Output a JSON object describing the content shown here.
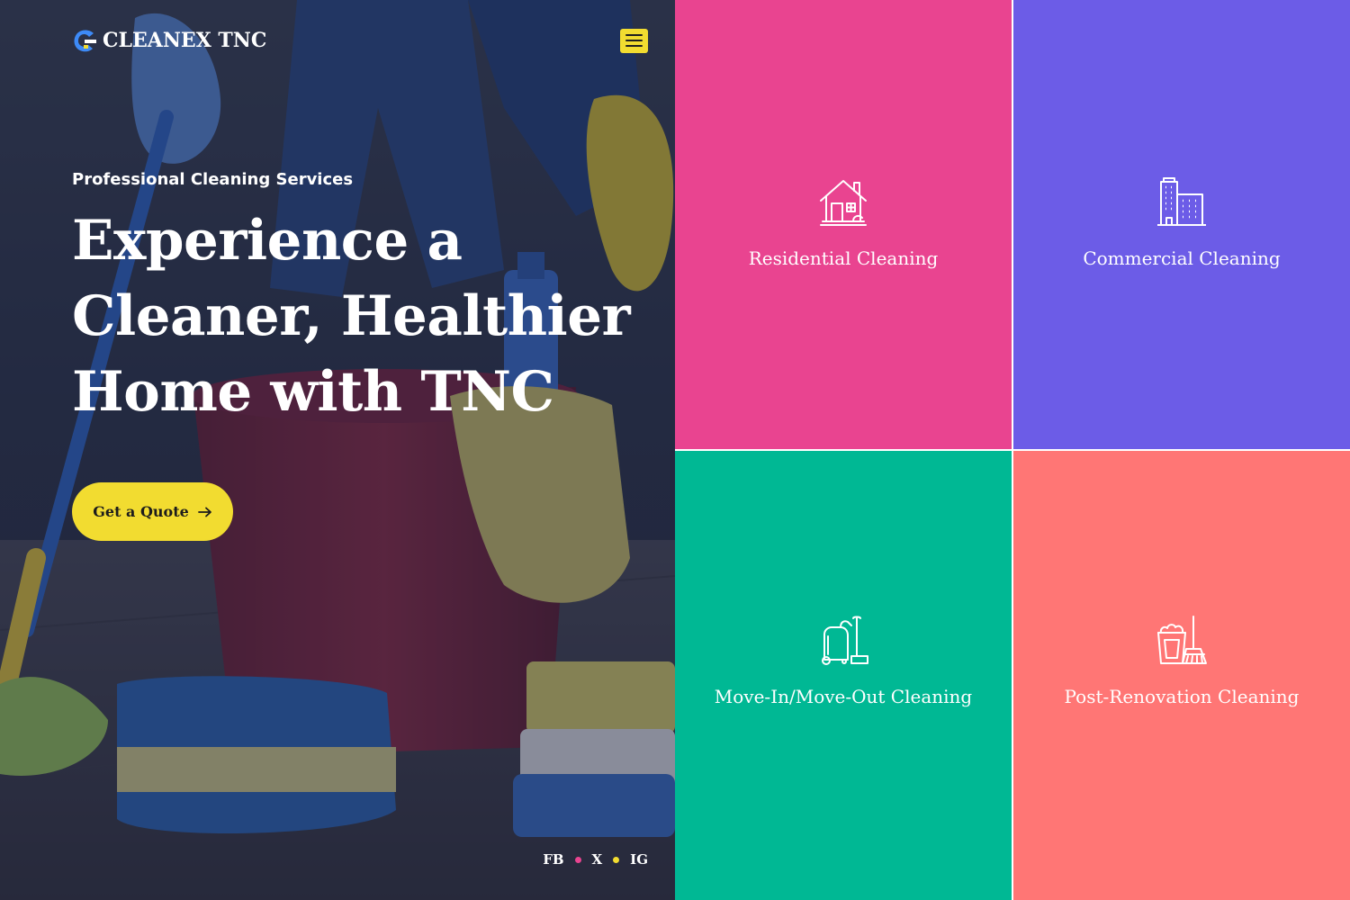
{
  "brand": {
    "name": "CLEANEX TNC",
    "logo_icon": "c-swoosh-logo-icon"
  },
  "nav": {
    "menu_icon": "hamburger-menu-icon"
  },
  "hero": {
    "kicker": "Professional Cleaning Services",
    "headline_lines": [
      "Experience a",
      "Cleaner, Healthier",
      "Home with TNC"
    ],
    "cta_label": "Get a Quote",
    "cta_icon": "arrow-right-icon",
    "background": "photo of person mopping floor with bucket, gloves and sponges"
  },
  "social": {
    "links": [
      "FB",
      "X",
      "IG"
    ],
    "dot_colors": [
      "#e94490",
      "#f2dc30"
    ]
  },
  "services": [
    {
      "title": "Residential Cleaning",
      "icon": "house-icon",
      "color": "#e94490"
    },
    {
      "title": "Commercial Cleaning",
      "icon": "office-building-icon",
      "color": "#6c5ce7"
    },
    {
      "title": "Move-In/Move-Out Cleaning",
      "icon": "vacuum-cleaner-icon",
      "color": "#00b894"
    },
    {
      "title": "Post-Renovation Cleaning",
      "icon": "bucket-broom-icon",
      "color": "#ff7675"
    }
  ],
  "colors": {
    "accent": "#f2dc30",
    "overlay": "#181e3a",
    "pink": "#e94490",
    "purple": "#6c5ce7",
    "green": "#00b894",
    "coral": "#ff7675"
  }
}
